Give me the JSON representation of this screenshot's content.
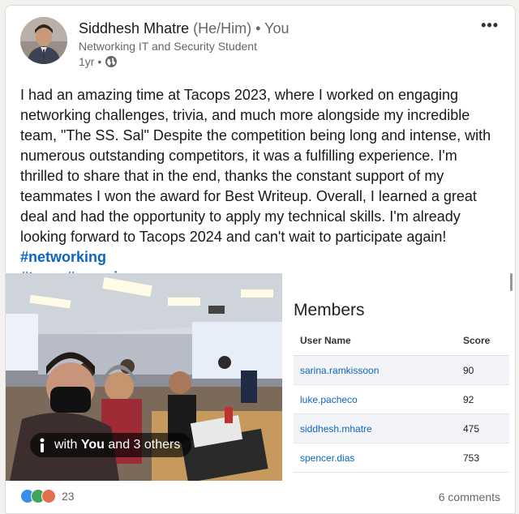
{
  "post": {
    "author": {
      "name": "Siddhesh Mhatre",
      "pronouns": "(He/Him)",
      "relation": "• You",
      "headline": "Networking IT and Security Student",
      "time": "1yr •"
    },
    "text": "I had an amazing time at Tacops 2023, where I worked on engaging networking challenges, trivia, and much more alongside my incredible team, \"The SS. Sal\" Despite the competition being long and intense, with numerous outstanding competitors, it was a fulfilling experience. I'm thrilled to share that in the end, thanks the constant support of my teammates I won the award for Best Writeup. Overall, I learned a great deal and had the opportunity to apply my technical skills. I'm already looking forward to Tacops 2024 and can't wait to participate again!",
    "hashtags": [
      "#networking",
      "#team",
      "#experience"
    ],
    "photo_tag": {
      "prefix": "with",
      "you": "You",
      "suffix": "and 3 others"
    },
    "members": {
      "title": "Members",
      "headers": [
        "User Name",
        "Score"
      ],
      "rows": [
        {
          "user": "sarina.ramkissoon",
          "score": "90"
        },
        {
          "user": "luke.pacheco",
          "score": "92"
        },
        {
          "user": "siddhesh.mhatre",
          "score": "475"
        },
        {
          "user": "spencer.dias",
          "score": "753"
        }
      ]
    },
    "reaction_count": "23",
    "comments": "6 comments",
    "more_label": "•••"
  },
  "colors": {
    "link": "#0a66c2",
    "muted": "#666666"
  }
}
